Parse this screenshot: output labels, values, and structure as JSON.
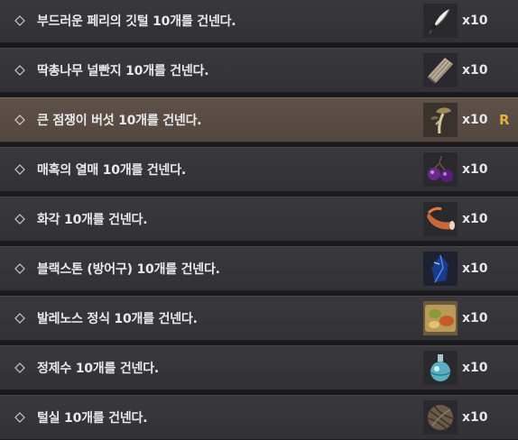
{
  "colors": {
    "row_bg": "#36363a",
    "selected_row_bg": "#5a4d44",
    "text": "#e9e9ea",
    "key_hint": "#e4b13a",
    "bullet": "#c8c8cc"
  },
  "items": [
    {
      "label": "부드러운 페리의 깃털 10개를 건넨다.",
      "qty": "x10",
      "icon": "feather-icon"
    },
    {
      "label": "딱총나무 널빤지 10개를 건넨다.",
      "qty": "x10",
      "icon": "wood-plank-icon"
    },
    {
      "label": "큰 점쟁이 버섯 10개를 건넨다.",
      "qty": "x10",
      "icon": "mushroom-icon",
      "selected": true,
      "key_hint": "R"
    },
    {
      "label": "매혹의 열매 10개를 건넨다.",
      "qty": "x10",
      "icon": "berry-icon"
    },
    {
      "label": "화각 10개를 건넨다.",
      "qty": "x10",
      "icon": "horn-icon"
    },
    {
      "label": "블랙스톤 (방어구) 10개를 건넨다.",
      "qty": "x10",
      "icon": "blackstone-icon"
    },
    {
      "label": "발레노스 정식 10개를 건넨다.",
      "qty": "x10",
      "icon": "meal-icon"
    },
    {
      "label": "정제수 10개를 건넨다.",
      "qty": "x10",
      "icon": "water-flask-icon"
    },
    {
      "label": "털실 10개를 건넨다.",
      "qty": "x10",
      "icon": "yarn-icon"
    }
  ]
}
